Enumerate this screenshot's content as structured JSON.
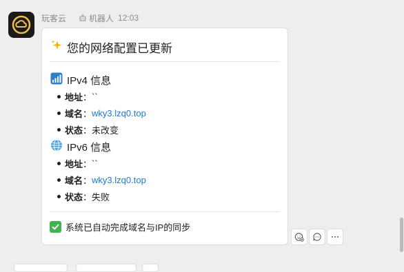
{
  "header": {
    "sender_name": "玩客云",
    "bot_label": "机器人",
    "time": "12:03"
  },
  "card": {
    "title_emoji": "✨",
    "title": "您的网络配置已更新",
    "ipv4": {
      "icon": "signal-bars-icon",
      "heading": "IPv4 信息",
      "rows": [
        {
          "label": "地址",
          "sep": "：",
          "value": "``"
        },
        {
          "label": "域名",
          "sep": "：",
          "value": "wky3.lzq0.top"
        },
        {
          "label": "状态",
          "sep": "：",
          "value": "未改变"
        }
      ]
    },
    "ipv6": {
      "icon": "globe-icon",
      "heading": "IPv6 信息",
      "rows": [
        {
          "label": "地址",
          "sep": "：",
          "value": "``"
        },
        {
          "label": "域名",
          "sep": "：",
          "value": "wky3.lzq0.top"
        },
        {
          "label": "状态",
          "sep": "：",
          "value": "失败"
        }
      ]
    },
    "footer": {
      "icon": "check-mark-icon",
      "text": "系统已自动完成域名与IP的同步"
    }
  },
  "actions": [
    "add-reaction-icon",
    "reply-icon",
    "more-icon"
  ],
  "colors": {
    "link": "#1e78d6",
    "check": "#3fb450",
    "avatar_bg": "#1b1b1b",
    "avatar_fg": "#f0c049"
  }
}
